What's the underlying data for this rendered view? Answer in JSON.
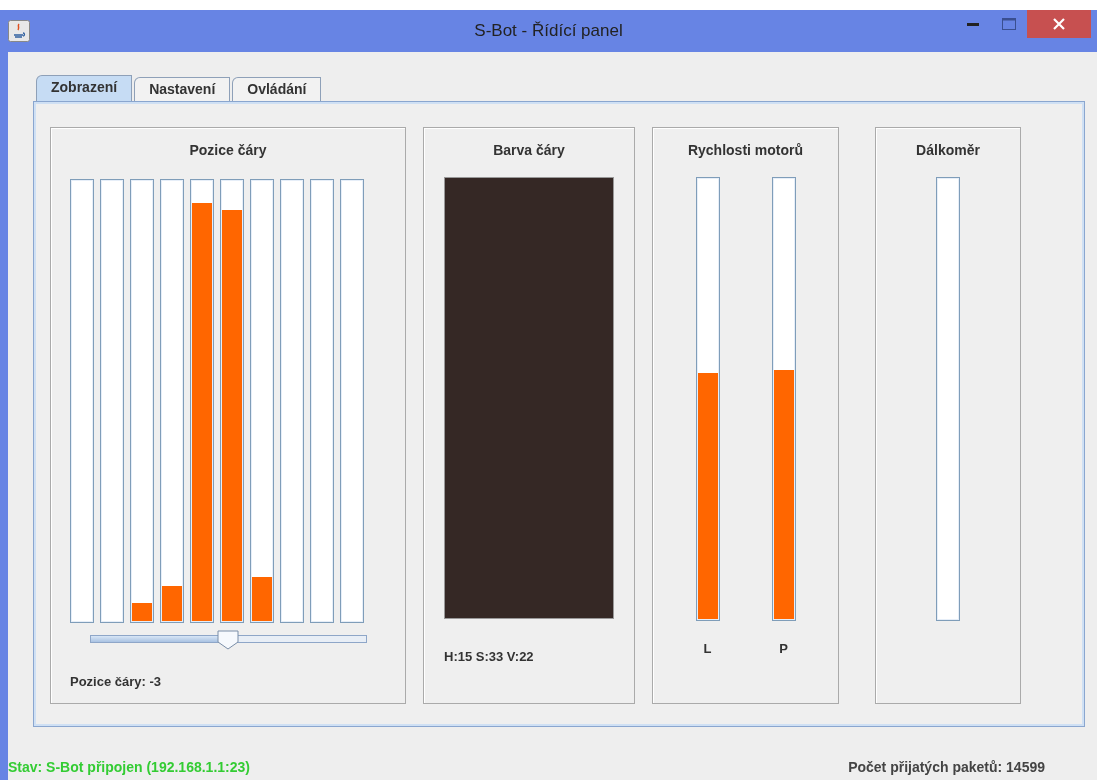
{
  "window": {
    "title": "S-Bot - Řídící panel"
  },
  "tabs": [
    {
      "label": "Zobrazení",
      "selected": true
    },
    {
      "label": "Nastavení",
      "selected": false
    },
    {
      "label": "Ovládání",
      "selected": false
    }
  ],
  "line_position": {
    "title": "Pozice čáry",
    "sensors": [
      {
        "level": 0
      },
      {
        "level": 0
      },
      {
        "level": 0.04
      },
      {
        "level": 0.08
      },
      {
        "level": 0.95
      },
      {
        "level": 0.935
      },
      {
        "level": 0.1
      },
      {
        "level": 0
      },
      {
        "level": 0
      },
      {
        "level": 0
      }
    ],
    "slider": {
      "level": 0.5
    },
    "reading": "Pozice čáry: -3"
  },
  "line_color": {
    "title": "Barva čáry",
    "color": "#352825",
    "reading": "H:15 S:33 V:22"
  },
  "motor_speeds": {
    "title": "Rychlosti motorů",
    "motors": [
      {
        "label": "L",
        "level": 0.56
      },
      {
        "label": "P",
        "level": 0.565
      }
    ]
  },
  "rangefinder": {
    "title": "Dálkoměr",
    "level": 0
  },
  "status_bar": {
    "state": "Stav: S-Bot připojen (192.168.1.1:23)",
    "packets": "Počet přijatých paketů: 14599"
  }
}
